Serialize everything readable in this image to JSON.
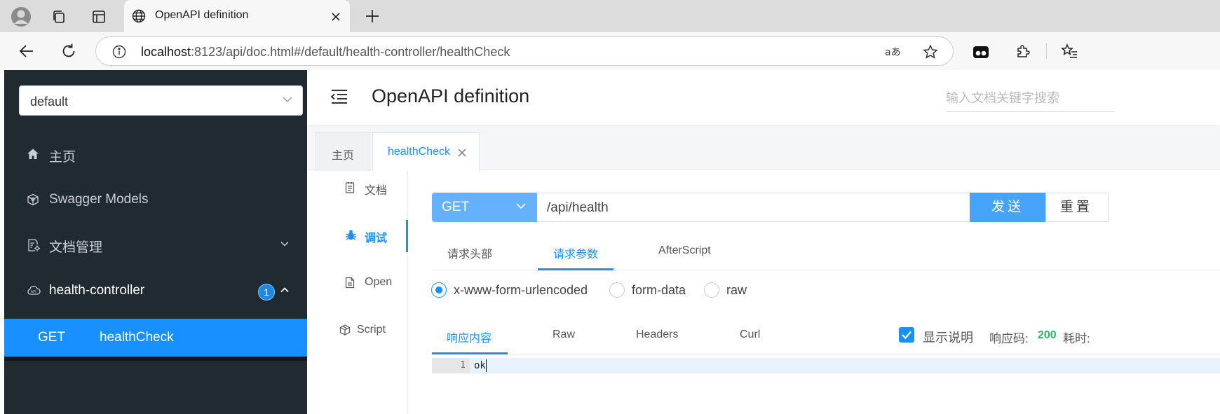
{
  "browser": {
    "tab_title": "OpenAPI definition",
    "url_host": "localhost",
    "url_rest": ":8123/api/doc.html#/default/health-controller/healthCheck"
  },
  "sidebar": {
    "group_select": "default",
    "items": [
      {
        "label": "主页"
      },
      {
        "label": "Swagger Models"
      },
      {
        "label": "文档管理"
      },
      {
        "label": "health-controller",
        "badge": "1"
      }
    ],
    "sub_item": {
      "method": "GET",
      "name": "healthCheck"
    }
  },
  "header": {
    "title": "OpenAPI definition",
    "search_placeholder": "输入文档关键字搜索"
  },
  "doc_tabs": [
    {
      "label": "主页"
    },
    {
      "label": "healthCheck"
    }
  ],
  "vnav": [
    {
      "label": "文档"
    },
    {
      "label": "调试"
    },
    {
      "label": "Open"
    },
    {
      "label": "Script"
    }
  ],
  "request": {
    "method": "GET",
    "path": "/api/health",
    "send_label": "发送",
    "reset_label": "重置"
  },
  "param_tabs": [
    {
      "label": "请求头部"
    },
    {
      "label": "请求参数"
    },
    {
      "label": "AfterScript"
    }
  ],
  "body_types": [
    {
      "label": "x-www-form-urlencoded",
      "checked": true
    },
    {
      "label": "form-data",
      "checked": false
    },
    {
      "label": "raw",
      "checked": false
    }
  ],
  "response_tabs": [
    {
      "label": "响应内容"
    },
    {
      "label": "Raw"
    },
    {
      "label": "Headers"
    },
    {
      "label": "Curl"
    }
  ],
  "response_meta": {
    "show_desc_label": "显示说明",
    "code_label": "响应码:",
    "code_value": "200",
    "time_label": "耗时:"
  },
  "editor": {
    "line_number": "1",
    "content": "ok"
  },
  "colors": {
    "accent": "#1890ff",
    "sidebar_bg": "#1f2a31",
    "success": "#2fb36a"
  }
}
